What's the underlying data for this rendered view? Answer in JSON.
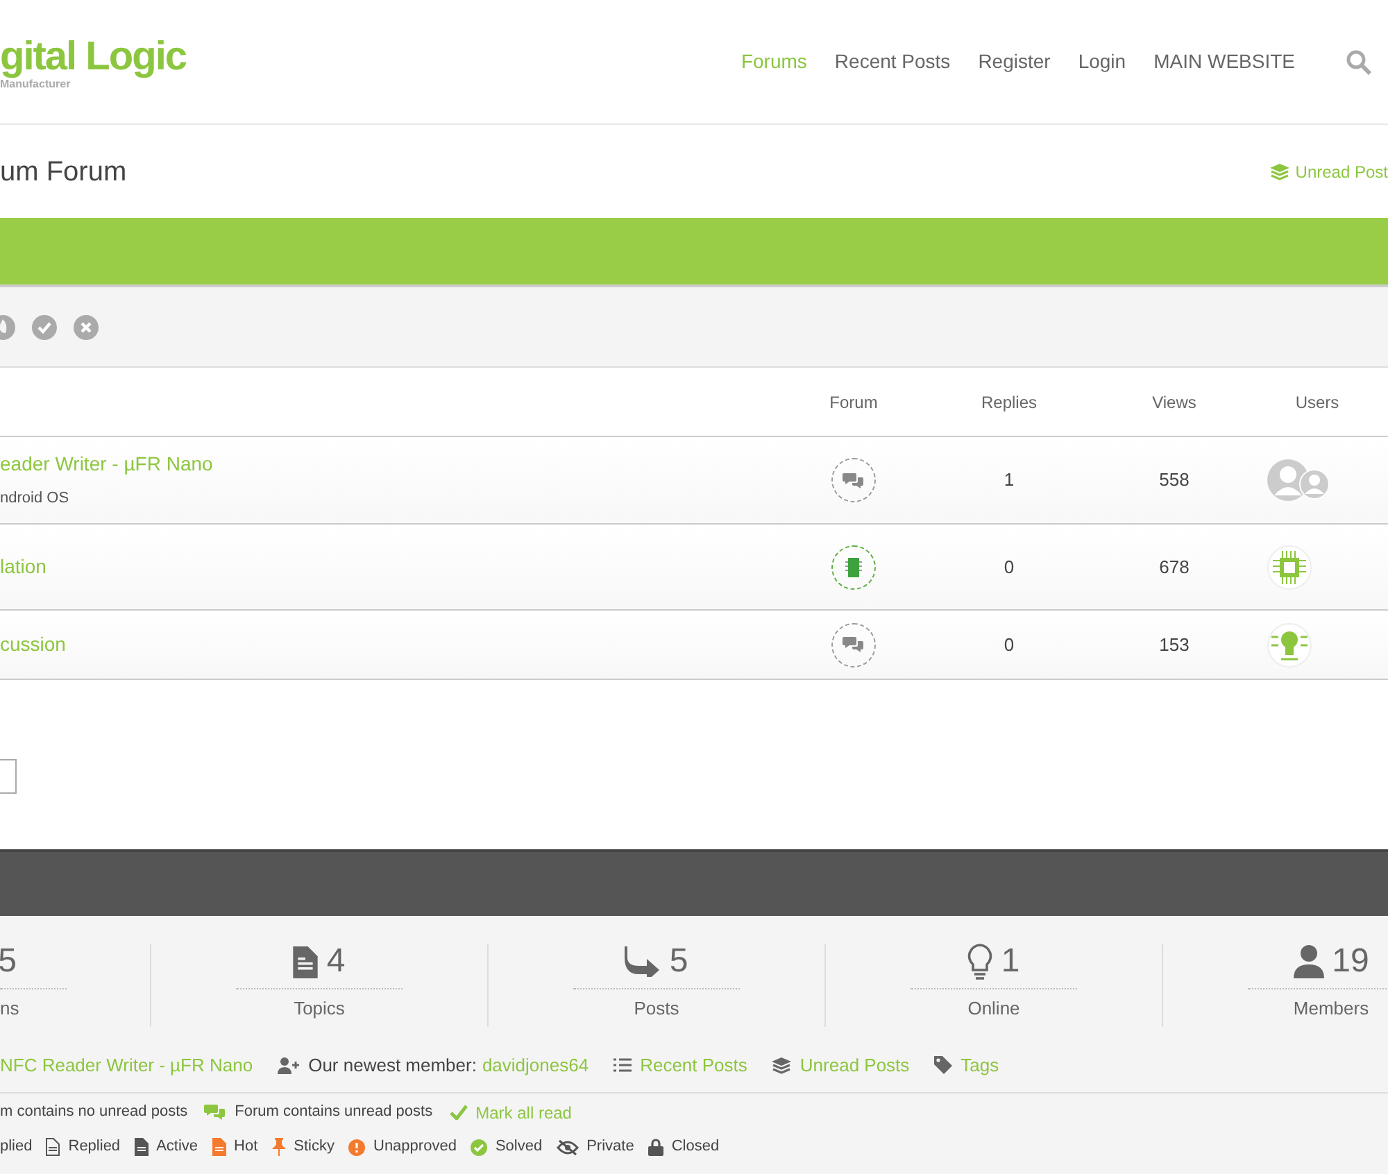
{
  "header": {
    "logo_text": "gital Logic",
    "logo_tagline": "Manufacturer",
    "nav": [
      {
        "label": "Forums",
        "selected": true
      },
      {
        "label": "Recent Posts",
        "selected": false
      },
      {
        "label": "Register",
        "selected": false
      },
      {
        "label": "Login",
        "selected": false
      },
      {
        "label": "MAIN WEBSITE",
        "selected": false
      }
    ]
  },
  "page_title": "um Forum",
  "unread_link": "Unread Post",
  "table": {
    "columns": [
      "Forum",
      "Replies",
      "Views",
      "Users"
    ],
    "rows": [
      {
        "title": "eader Writer - µFR Nano",
        "subtitle": "ndroid OS",
        "kind": "discussion",
        "replies": "1",
        "views": "558"
      },
      {
        "title": "lation",
        "kind": "hardware",
        "replies": "0",
        "views": "678"
      },
      {
        "title": "cussion",
        "kind": "discussion",
        "replies": "0",
        "views": "153"
      }
    ]
  },
  "stats": [
    {
      "value": "5",
      "label": "ns"
    },
    {
      "value": "4",
      "label": "Topics"
    },
    {
      "value": "5",
      "label": "Posts"
    },
    {
      "value": "1",
      "label": "Online"
    },
    {
      "value": "19",
      "label": "Members"
    }
  ],
  "info": [
    {
      "kind": "link",
      "text": "NFC Reader Writer - µFR Nano"
    },
    {
      "kind": "member",
      "text": "Our newest member:",
      "link": "davidjones64"
    },
    {
      "kind": "list",
      "link": "Recent Posts"
    },
    {
      "kind": "layers",
      "link": "Unread Posts"
    },
    {
      "kind": "tag",
      "link": "Tags"
    }
  ],
  "legend_1": [
    {
      "kind": "plain",
      "text": "m contains no unread posts"
    },
    {
      "kind": "unread",
      "text": "Forum contains unread posts"
    },
    {
      "kind": "action",
      "text": "Mark all read"
    }
  ],
  "legend_2": [
    {
      "kind": "plain",
      "text": "plied"
    },
    {
      "kind": "replied",
      "text": "Replied"
    },
    {
      "kind": "active",
      "text": "Active"
    },
    {
      "kind": "hot",
      "text": "Hot"
    },
    {
      "kind": "sticky",
      "text": "Sticky"
    },
    {
      "kind": "unapproved",
      "text": "Unapproved"
    },
    {
      "kind": "solved",
      "text": "Solved"
    },
    {
      "kind": "private",
      "text": "Private"
    },
    {
      "kind": "closed",
      "text": "Closed"
    }
  ]
}
